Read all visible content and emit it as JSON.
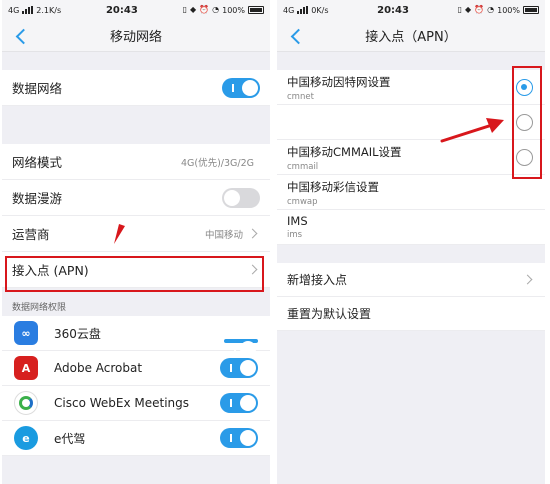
{
  "left": {
    "status": {
      "network": "4G",
      "speed": "2.1K/s",
      "time": "20:43",
      "battery": "100%"
    },
    "nav": {
      "title": "移动网络"
    },
    "data_network": {
      "label": "数据网络",
      "enabled": true
    },
    "settings": [
      {
        "label": "网络模式",
        "value": "4G(优先)/3G/2G"
      },
      {
        "label": "数据漫游",
        "value": ""
      },
      {
        "label": "运营商",
        "value": "中国移动"
      },
      {
        "label": "接入点 (APN)",
        "value": ""
      }
    ],
    "permissions": {
      "header": "数据网络权限",
      "apps": [
        {
          "name": "360云盘",
          "icon": "cloud-icon"
        },
        {
          "name": "Adobe Acrobat",
          "icon": "acrobat-icon"
        },
        {
          "name": "Cisco WebEx Meetings",
          "icon": "webex-icon"
        },
        {
          "name": "e代驾",
          "icon": "edaijia-icon"
        }
      ]
    }
  },
  "right": {
    "status": {
      "network": "4G",
      "speed": "0K/s",
      "time": "20:43",
      "battery": "100%"
    },
    "nav": {
      "title": "接入点（APN）"
    },
    "apns": [
      {
        "name": "中国移动因特网设置",
        "sub": "cmnet",
        "selected": true
      },
      {
        "name": "",
        "sub": "",
        "selected": false
      },
      {
        "name": "中国移动CMMAIL设置",
        "sub": "cmmail",
        "selected": false
      },
      {
        "name": "中国移动彩信设置",
        "sub": "cmwap",
        "selected": false
      },
      {
        "name": "IMS",
        "sub": "ims",
        "selected": false
      }
    ],
    "actions": [
      {
        "label": "新增接入点"
      },
      {
        "label": "重置为默认设置"
      }
    ]
  },
  "colors": {
    "accent": "#2a9be8",
    "highlight": "#d8171c"
  }
}
